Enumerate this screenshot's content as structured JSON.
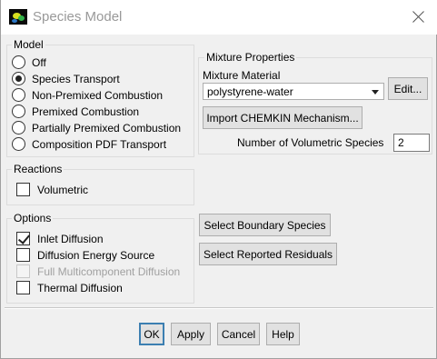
{
  "window": {
    "title": "Species Model"
  },
  "model": {
    "label": "Model",
    "options": [
      {
        "label": "Off",
        "selected": false
      },
      {
        "label": "Species Transport",
        "selected": true
      },
      {
        "label": "Non-Premixed Combustion",
        "selected": false
      },
      {
        "label": "Premixed Combustion",
        "selected": false
      },
      {
        "label": "Partially Premixed Combustion",
        "selected": false
      },
      {
        "label": "Composition PDF Transport",
        "selected": false
      }
    ]
  },
  "mixture": {
    "label": "Mixture Properties",
    "material_label": "Mixture Material",
    "material_value": "polystyrene-water",
    "edit_label": "Edit...",
    "import_label": "Import CHEMKIN Mechanism...",
    "num_species_label": "Number of Volumetric Species",
    "num_species_value": "2"
  },
  "reactions": {
    "label": "Reactions",
    "volumetric": {
      "label": "Volumetric",
      "checked": false
    }
  },
  "options": {
    "label": "Options",
    "items": [
      {
        "label": "Inlet Diffusion",
        "checked": true,
        "enabled": true
      },
      {
        "label": "Diffusion Energy Source",
        "checked": false,
        "enabled": true
      },
      {
        "label": "Full Multicomponent Diffusion",
        "checked": false,
        "enabled": false
      },
      {
        "label": "Thermal Diffusion",
        "checked": false,
        "enabled": true
      }
    ]
  },
  "buttons": {
    "select_boundary": "Select Boundary Species",
    "select_residuals": "Select Reported Residuals",
    "ok": "OK",
    "apply": "Apply",
    "cancel": "Cancel",
    "help": "Help"
  }
}
